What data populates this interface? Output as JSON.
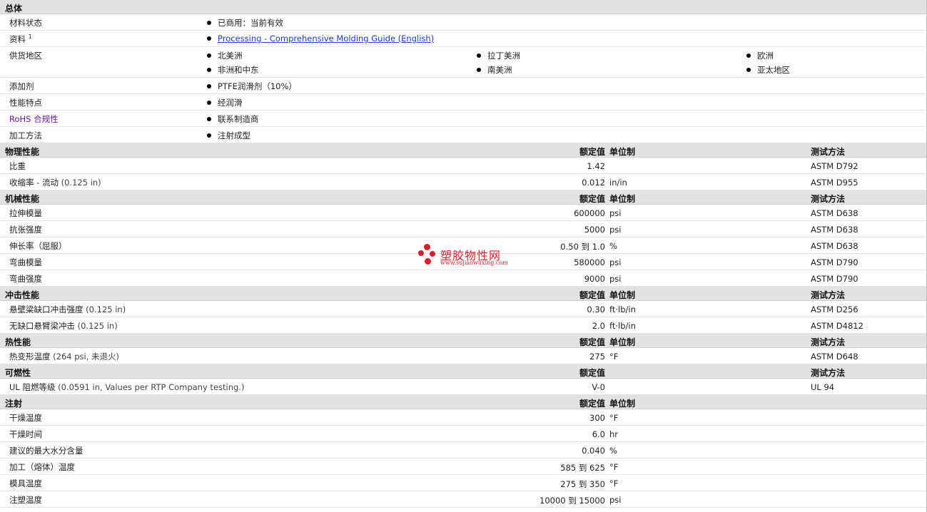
{
  "general": {
    "title": "总体",
    "material_status": {
      "label": "材料状态",
      "value": "已商用：当前有效"
    },
    "documents": {
      "label": "资料",
      "sup": "1",
      "link": "Processing - Comprehensive Molding Guide (English)"
    },
    "availability": {
      "label": "供货地区",
      "regions": [
        "北美洲",
        "拉丁美洲",
        "欧洲",
        "非洲和中东",
        "南美洲",
        "亚太地区"
      ]
    },
    "additives": {
      "label": "添加剂",
      "value": "PTFE润滑剂（10%）"
    },
    "features": {
      "label": "性能特点",
      "value": "经润滑"
    },
    "rohs": {
      "label": "RoHS 合规性",
      "value": "联系制造商"
    },
    "processing": {
      "label": "加工方法",
      "value": "注射成型"
    }
  },
  "headers": {
    "nominal": "额定值",
    "unit": "单位制",
    "method": "测试方法"
  },
  "physical": {
    "title": "物理性能",
    "rows": [
      {
        "label": "比重",
        "cond": "",
        "value": "1.42",
        "unit": "",
        "method": "ASTM D792"
      },
      {
        "label": "收缩率 - 流动",
        "cond": "(0.125 in)",
        "value": "0.012",
        "unit": "in/in",
        "method": "ASTM D955"
      }
    ]
  },
  "mechanical": {
    "title": "机械性能",
    "rows": [
      {
        "label": "拉伸模量",
        "cond": "",
        "value": "600000",
        "unit": "psi",
        "method": "ASTM D638"
      },
      {
        "label": "抗张强度",
        "cond": "",
        "value": "5000",
        "unit": "psi",
        "method": "ASTM D638"
      },
      {
        "label": "伸长率（屈服）",
        "cond": "",
        "value": "0.50 到 1.0",
        "unit": "%",
        "method": "ASTM D638"
      },
      {
        "label": "弯曲模量",
        "cond": "",
        "value": "580000",
        "unit": "psi",
        "method": "ASTM D790"
      },
      {
        "label": "弯曲强度",
        "cond": "",
        "value": "9000",
        "unit": "psi",
        "method": "ASTM D790"
      }
    ]
  },
  "impact": {
    "title": "冲击性能",
    "rows": [
      {
        "label": "悬壁梁缺口冲击强度",
        "cond": "(0.125 in)",
        "value": "0.30",
        "unit": "ft·lb/in",
        "method": "ASTM D256"
      },
      {
        "label": "无缺口悬臂梁冲击",
        "cond": "(0.125 in)",
        "value": "2.0",
        "unit": "ft·lb/in",
        "method": "ASTM D4812"
      }
    ]
  },
  "thermal": {
    "title": "热性能",
    "rows": [
      {
        "label": "热变形温度",
        "cond": "(264 psi, 未退火)",
        "value": "275",
        "unit": "°F",
        "method": "ASTM D648"
      }
    ]
  },
  "flammability": {
    "title": "可燃性",
    "rows": [
      {
        "label": "UL 阻燃等级",
        "cond": "(0.0591 in, Values per RTP Company testing.)",
        "value": "V-0",
        "unit": "",
        "method": "UL 94"
      }
    ]
  },
  "injection": {
    "title": "注射",
    "rows": [
      {
        "label": "干燥温度",
        "value": "300",
        "unit": "°F"
      },
      {
        "label": "干燥时间",
        "value": "6.0",
        "unit": "hr"
      },
      {
        "label": "建议的最大水分含量",
        "value": "0.040",
        "unit": "%"
      },
      {
        "label": "加工（熔体）温度",
        "value": "585 到 625",
        "unit": "°F"
      },
      {
        "label": "模具温度",
        "value": "275 到 350",
        "unit": "°F"
      },
      {
        "label": "注塑温度",
        "value": "10000 到 15000",
        "unit": "psi"
      }
    ]
  },
  "watermark": {
    "cn": "塑胶物性网",
    "url": "www.sujiaowuxing.com",
    "color": "#e2192b"
  }
}
